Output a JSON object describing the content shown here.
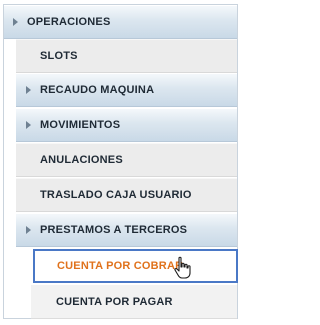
{
  "menu": {
    "items": [
      {
        "label": "OPERACIONES"
      },
      {
        "label": "SLOTS"
      },
      {
        "label": "RECAUDO MAQUINA"
      },
      {
        "label": "MOVIMIENTOS"
      },
      {
        "label": "ANULACIONES"
      },
      {
        "label": "TRASLADO CAJA USUARIO"
      },
      {
        "label": "PRESTAMOS A TERCEROS"
      },
      {
        "label": "CUENTA POR COBRAR"
      },
      {
        "label": "CUENTA POR PAGAR"
      }
    ]
  },
  "icons": {
    "expand": "chevron-right-icon",
    "pointer": "hand-pointer-icon"
  },
  "colors": {
    "active_text": "#e0721c",
    "active_border": "#4a78c6"
  }
}
